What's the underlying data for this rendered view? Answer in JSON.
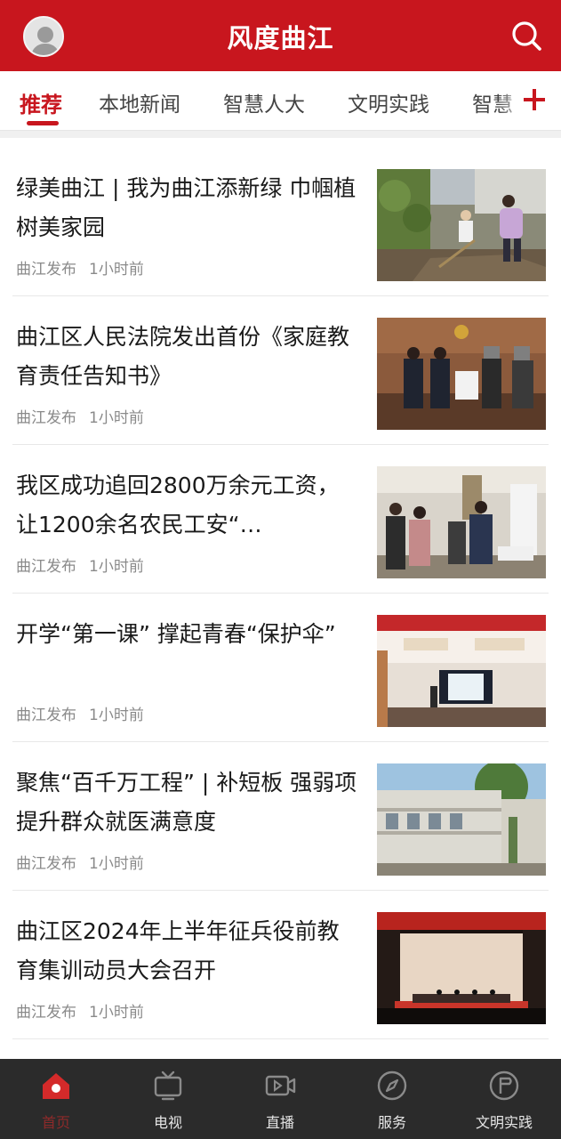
{
  "header": {
    "title": "风度曲江"
  },
  "tabs": [
    {
      "label": "推荐",
      "active": true
    },
    {
      "label": "本地新闻",
      "active": false
    },
    {
      "label": "智慧人大",
      "active": false
    },
    {
      "label": "文明实践",
      "active": false
    },
    {
      "label": "智慧",
      "active": false
    }
  ],
  "news": [
    {
      "title": "绿美曲江 | 我为曲江添新绿 巾帼植树美家园",
      "source": "曲江发布",
      "time": "1小时前"
    },
    {
      "title": "曲江区人民法院发出首份《家庭教育责任告知书》",
      "source": "曲江发布",
      "time": "1小时前"
    },
    {
      "title": "我区成功追回2800万余元工资，让1200余名农民工安“…",
      "source": "曲江发布",
      "time": "1小时前"
    },
    {
      "title": "开学“第一课” 撑起青春“保护伞”",
      "source": "曲江发布",
      "time": "1小时前"
    },
    {
      "title": "聚焦“百千万工程” | 补短板 强弱项 提升群众就医满意度",
      "source": "曲江发布",
      "time": "1小时前"
    },
    {
      "title": "曲江区2024年上半年征兵役前教育集训动员大会召开",
      "source": "曲江发布",
      "time": "1小时前"
    }
  ],
  "bottom_nav": [
    {
      "label": "首页",
      "icon": "home-icon",
      "active": true
    },
    {
      "label": "电视",
      "icon": "tv-icon",
      "active": false
    },
    {
      "label": "直播",
      "icon": "live-video-icon",
      "active": false
    },
    {
      "label": "服务",
      "icon": "compass-icon",
      "active": false
    },
    {
      "label": "文明实践",
      "icon": "flag-badge-icon",
      "active": false
    }
  ],
  "colors": {
    "brand_red": "#c8161e",
    "nav_bg": "#2b2b2b"
  }
}
